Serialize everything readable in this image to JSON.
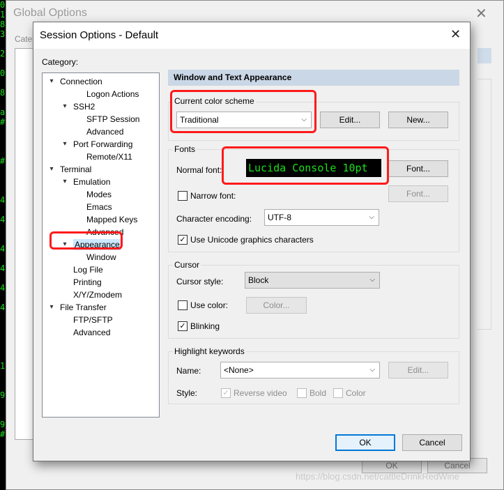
{
  "background_terminal": {
    "lines": [
      "0",
      "1",
      "8",
      "3",
      "",
      "2",
      "",
      "0",
      "",
      "8",
      "",
      "a",
      "#",
      "",
      "",
      "",
      "#",
      "",
      "",
      "",
      "4",
      "",
      "4",
      "",
      "",
      "4",
      "",
      "4",
      "",
      "4",
      "",
      "4",
      "",
      "",
      "",
      "",
      "",
      "1",
      "",
      "",
      "9",
      "",
      "",
      "9",
      "#"
    ]
  },
  "global_options": {
    "title": "Global Options",
    "category_label": "Cate",
    "ok_label": "OK",
    "cancel_label": "Cancel"
  },
  "dialog": {
    "title": "Session Options - Default",
    "category_label": "Category:",
    "tree": [
      {
        "label": "Connection",
        "level": 0,
        "toggle": "v"
      },
      {
        "label": "Logon Actions",
        "level": 2,
        "toggle": ""
      },
      {
        "label": "SSH2",
        "level": 1,
        "toggle": "v"
      },
      {
        "label": "SFTP Session",
        "level": 2,
        "toggle": ""
      },
      {
        "label": "Advanced",
        "level": 2,
        "toggle": ""
      },
      {
        "label": "Port Forwarding",
        "level": 1,
        "toggle": "v"
      },
      {
        "label": "Remote/X11",
        "level": 2,
        "toggle": ""
      },
      {
        "label": "Terminal",
        "level": 0,
        "toggle": "v"
      },
      {
        "label": "Emulation",
        "level": 1,
        "toggle": "v"
      },
      {
        "label": "Modes",
        "level": 2,
        "toggle": ""
      },
      {
        "label": "Emacs",
        "level": 2,
        "toggle": ""
      },
      {
        "label": "Mapped Keys",
        "level": 2,
        "toggle": ""
      },
      {
        "label": "Advanced",
        "level": 2,
        "toggle": ""
      },
      {
        "label": "Appearance",
        "level": 1,
        "toggle": "v",
        "selected": true
      },
      {
        "label": "Window",
        "level": 2,
        "toggle": ""
      },
      {
        "label": "Log File",
        "level": 1,
        "toggle": ""
      },
      {
        "label": "Printing",
        "level": 1,
        "toggle": ""
      },
      {
        "label": "X/Y/Zmodem",
        "level": 1,
        "toggle": ""
      },
      {
        "label": "File Transfer",
        "level": 0,
        "toggle": "v"
      },
      {
        "label": "FTP/SFTP",
        "level": 1,
        "toggle": ""
      },
      {
        "label": "Advanced",
        "level": 1,
        "toggle": ""
      }
    ],
    "section_header": "Window and Text Appearance",
    "color_scheme": {
      "group_label": "Current color scheme",
      "value": "Traditional",
      "edit_label": "Edit...",
      "new_label": "New..."
    },
    "fonts": {
      "group_label": "Fonts",
      "normal_font_label": "Normal font:",
      "normal_font_sample": "Lucida Console 10pt",
      "font_button": "Font...",
      "narrow_font_label": "Narrow font:",
      "narrow_font_checked": false,
      "narrow_font_button": "Font...",
      "encoding_label": "Character encoding:",
      "encoding_value": "UTF-8",
      "unicode_label": "Use Unicode graphics characters",
      "unicode_checked": true
    },
    "cursor": {
      "group_label": "Cursor",
      "style_label": "Cursor style:",
      "style_value": "Block",
      "use_color_label": "Use color:",
      "use_color_checked": false,
      "color_button": "Color...",
      "blinking_label": "Blinking",
      "blinking_checked": true
    },
    "highlight": {
      "group_label": "Highlight keywords",
      "name_label": "Name:",
      "name_value": "<None>",
      "edit_label": "Edit...",
      "style_label": "Style:",
      "reverse_video_label": "Reverse video",
      "bold_label": "Bold",
      "color_label": "Color"
    },
    "ok_label": "OK",
    "cancel_label": "Cancel"
  },
  "watermark": "https://blog.csdn.net/cattleDrinkRedWine",
  "colors": {
    "font_sample_fg": "#19e019",
    "font_sample_bg": "#000000",
    "annotation_red": "#ff1a1a",
    "selection": "#cce8ff",
    "header_bar": "#cad7e6"
  }
}
